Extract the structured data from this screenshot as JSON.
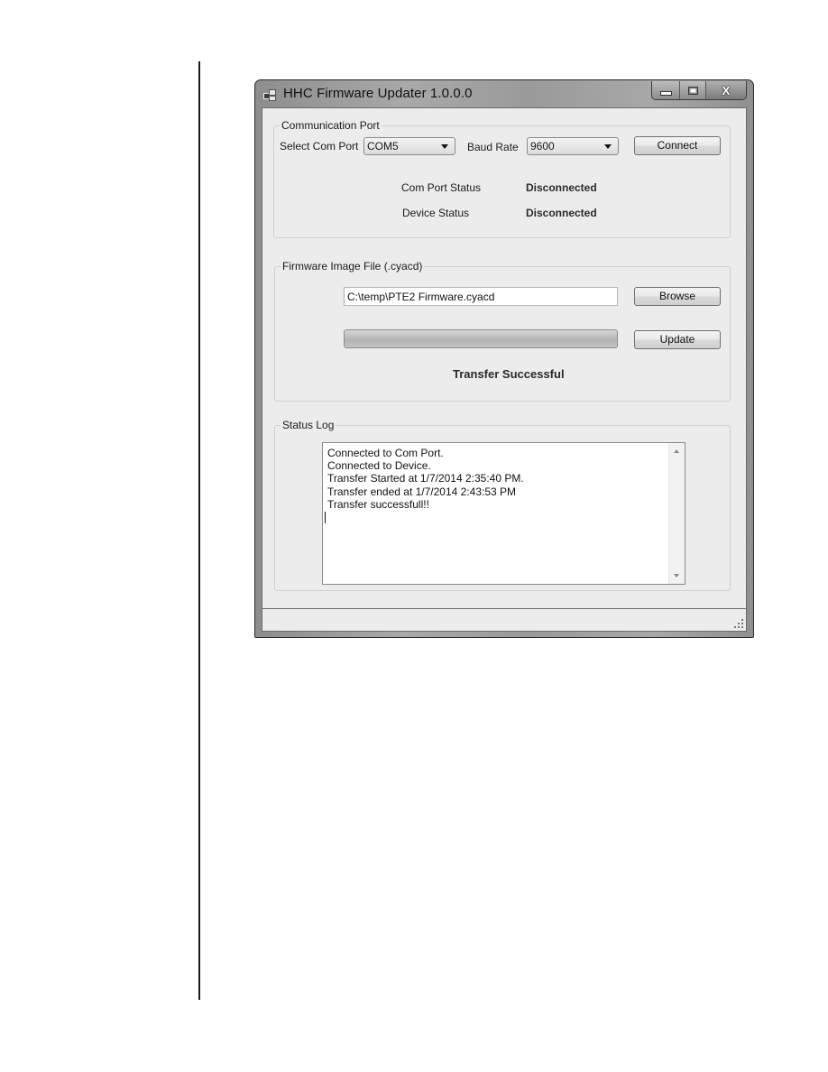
{
  "window": {
    "title": "HHC Firmware Updater 1.0.0.0",
    "caption_buttons": {
      "minimize": "minimize",
      "maximize": "maximize",
      "close": "X"
    }
  },
  "communication_port": {
    "legend": "Communication Port",
    "select_com_port_label": "Select Com Port",
    "com_port_value": "COM5",
    "baud_rate_label": "Baud Rate",
    "baud_rate_value": "9600",
    "connect_label": "Connect",
    "com_port_status_label": "Com Port Status",
    "com_port_status_value": "Disconnected",
    "device_status_label": "Device Status",
    "device_status_value": "Disconnected"
  },
  "firmware": {
    "legend": "Firmware Image File (.cyacd)",
    "file_path": "C:\\temp\\PTE2 Firmware.cyacd",
    "browse_label": "Browse",
    "update_label": "Update",
    "progress_percent": 100,
    "transfer_status": "Transfer Successful"
  },
  "status_log": {
    "legend": "Status Log",
    "lines": [
      "Connected to Com Port.",
      "Connected to Device.",
      "Transfer Started at 1/7/2014 2:35:40 PM.",
      "Transfer ended at 1/7/2014 2:43:53 PM",
      "Transfer successfull!!"
    ]
  },
  "colors": {
    "window_frame": "#9a9a9a",
    "client_bg": "#ececec",
    "progress_fill": "#bcbcbc"
  }
}
